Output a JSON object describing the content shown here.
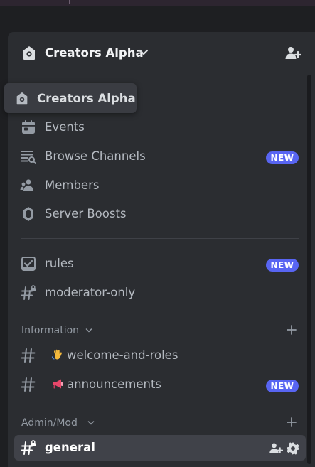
{
  "server": {
    "name": "Creators Alpha",
    "tooltip": "Creators Alpha"
  },
  "menu": [
    {
      "label": "Events",
      "icon": "calendar-icon",
      "badge": ""
    },
    {
      "label": "Browse Channels",
      "icon": "browse-channels-icon",
      "badge": "NEW"
    },
    {
      "label": "Members",
      "icon": "members-icon",
      "badge": ""
    },
    {
      "label": "Server Boosts",
      "icon": "boost-icon",
      "badge": ""
    }
  ],
  "channels_top": [
    {
      "name": "rules",
      "icon": "rules-icon",
      "badge": "NEW"
    },
    {
      "name": "moderator-only",
      "icon": "locked-hashtag-icon",
      "badge": ""
    }
  ],
  "categories": [
    {
      "name": "Information",
      "channels": [
        {
          "name": "welcome-and-roles",
          "emoji": "waving-hand-icon",
          "badge": ""
        },
        {
          "name": "announcements",
          "emoji": "megaphone-icon",
          "badge": "NEW"
        }
      ]
    },
    {
      "name": "Admin/Mod",
      "channels": [
        {
          "name": "general",
          "icon": "locked-hashtag-icon",
          "selected": true
        }
      ]
    }
  ],
  "colors": {
    "accent": "#5865f2",
    "panel": "#2b2d31",
    "background": "#1e1f22",
    "selected_row": "#404249",
    "muted_text": "#b5bac1"
  }
}
